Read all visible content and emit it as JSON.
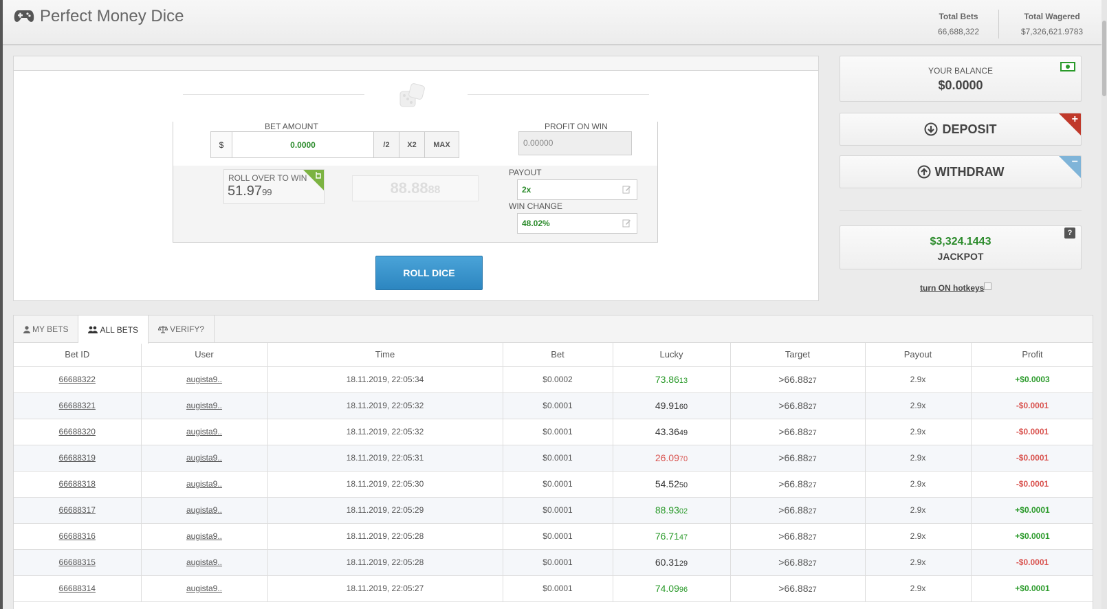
{
  "header": {
    "title": "Perfect Money Dice",
    "total_bets_label": "Total Bets",
    "total_bets_value": "66,688,322",
    "total_wagered_label": "Total Wagered",
    "total_wagered_value": "$7,326,621.9783"
  },
  "game": {
    "bet_amount_label": "BET AMOUNT",
    "currency": "$",
    "bet_amount_value": "0.0000",
    "half_label": "/2",
    "double_label": "X2",
    "max_label": "MAX",
    "profit_label": "PROFIT ON WIN",
    "profit_value": "0.00000",
    "roll_over_label": "ROLL OVER TO WIN",
    "roll_over_main": "51.97",
    "roll_over_small": "99",
    "result_main": "88.88",
    "result_small": "88",
    "payout_label": "PAYOUT",
    "payout_value": "2x",
    "win_chance_label": "WIN CHANGE",
    "win_chance_value": "48.02%",
    "roll_button": "ROLL DICE"
  },
  "sidebar": {
    "balance_label": "YOUR BALANCE",
    "balance_value": "$0.0000",
    "deposit_label": "DEPOSIT",
    "withdraw_label": "WITHDRAW",
    "jackpot_value": "$3,324.1443",
    "jackpot_label": "JACKPOT",
    "help_label": "?",
    "hotkeys_label": "turn ON hotkeys"
  },
  "tabs": {
    "my_bets": "MY BETS",
    "all_bets": "ALL BETS",
    "verify": "VERIFY?"
  },
  "table": {
    "columns": [
      "Bet ID",
      "User",
      "Time",
      "Bet",
      "Lucky",
      "Target",
      "Payout",
      "Profit"
    ],
    "rows": [
      {
        "id": "66688322",
        "user": "augista9..",
        "time": "18.11.2019, 22:05:34",
        "bet": "$0.0002",
        "lucky_main": "73.86",
        "lucky_small": "13",
        "lucky_class": "win",
        "target_main": ">66.88",
        "target_small": "27",
        "payout": "2.9x",
        "profit": "+$0.0003",
        "profit_class": "win"
      },
      {
        "id": "66688321",
        "user": "augista9..",
        "time": "18.11.2019, 22:05:32",
        "bet": "$0.0001",
        "lucky_main": "49.91",
        "lucky_small": "60",
        "lucky_class": "neutral",
        "target_main": ">66.88",
        "target_small": "27",
        "payout": "2.9x",
        "profit": "-$0.0001",
        "profit_class": "loss"
      },
      {
        "id": "66688320",
        "user": "augista9..",
        "time": "18.11.2019, 22:05:32",
        "bet": "$0.0001",
        "lucky_main": "43.36",
        "lucky_small": "49",
        "lucky_class": "neutral",
        "target_main": ">66.88",
        "target_small": "27",
        "payout": "2.9x",
        "profit": "-$0.0001",
        "profit_class": "loss"
      },
      {
        "id": "66688319",
        "user": "augista9..",
        "time": "18.11.2019, 22:05:31",
        "bet": "$0.0001",
        "lucky_main": "26.09",
        "lucky_small": "70",
        "lucky_class": "loss",
        "target_main": ">66.88",
        "target_small": "27",
        "payout": "2.9x",
        "profit": "-$0.0001",
        "profit_class": "loss"
      },
      {
        "id": "66688318",
        "user": "augista9..",
        "time": "18.11.2019, 22:05:30",
        "bet": "$0.0001",
        "lucky_main": "54.52",
        "lucky_small": "50",
        "lucky_class": "neutral",
        "target_main": ">66.88",
        "target_small": "27",
        "payout": "2.9x",
        "profit": "-$0.0001",
        "profit_class": "loss"
      },
      {
        "id": "66688317",
        "user": "augista9..",
        "time": "18.11.2019, 22:05:29",
        "bet": "$0.0001",
        "lucky_main": "88.93",
        "lucky_small": "02",
        "lucky_class": "win",
        "target_main": ">66.88",
        "target_small": "27",
        "payout": "2.9x",
        "profit": "+$0.0001",
        "profit_class": "win"
      },
      {
        "id": "66688316",
        "user": "augista9..",
        "time": "18.11.2019, 22:05:28",
        "bet": "$0.0001",
        "lucky_main": "76.71",
        "lucky_small": "47",
        "lucky_class": "win",
        "target_main": ">66.88",
        "target_small": "27",
        "payout": "2.9x",
        "profit": "+$0.0001",
        "profit_class": "win"
      },
      {
        "id": "66688315",
        "user": "augista9..",
        "time": "18.11.2019, 22:05:28",
        "bet": "$0.0001",
        "lucky_main": "60.31",
        "lucky_small": "29",
        "lucky_class": "neutral",
        "target_main": ">66.88",
        "target_small": "27",
        "payout": "2.9x",
        "profit": "-$0.0001",
        "profit_class": "loss"
      },
      {
        "id": "66688314",
        "user": "augista9..",
        "time": "18.11.2019, 22:05:27",
        "bet": "$0.0001",
        "lucky_main": "74.09",
        "lucky_small": "96",
        "lucky_class": "win",
        "target_main": ">66.88",
        "target_small": "27",
        "payout": "2.9x",
        "profit": "+$0.0001",
        "profit_class": "win"
      }
    ]
  }
}
